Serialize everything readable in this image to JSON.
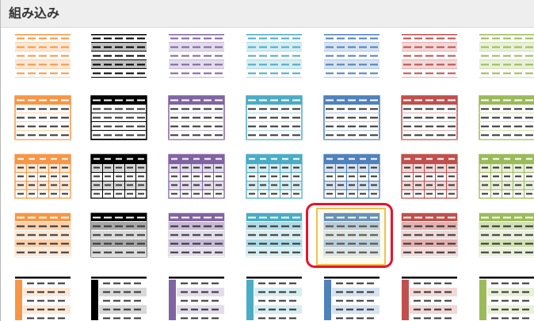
{
  "section": {
    "title": "組み込み"
  },
  "colors": [
    "#f79646",
    "#000000",
    "#8064a2",
    "#4bacc6",
    "#4f81bd",
    "#c0504d",
    "#9bbb59"
  ],
  "rows": [
    "light-lines",
    "medium-header",
    "grid",
    "banded",
    "first-column"
  ],
  "selected": {
    "row": 3,
    "col": 4
  }
}
